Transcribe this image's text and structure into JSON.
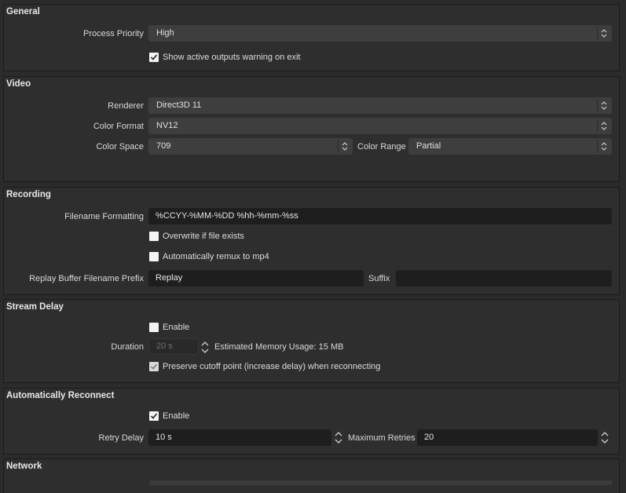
{
  "general": {
    "title": "General",
    "process_priority_label": "Process Priority",
    "process_priority_value": "High",
    "show_warning_label": "Show active outputs warning on exit",
    "show_warning_checked": true
  },
  "video": {
    "title": "Video",
    "renderer_label": "Renderer",
    "renderer_value": "Direct3D 11",
    "color_format_label": "Color Format",
    "color_format_value": "NV12",
    "color_space_label": "Color Space",
    "color_space_value": "709",
    "color_range_label": "Color Range",
    "color_range_value": "Partial"
  },
  "recording": {
    "title": "Recording",
    "filename_formatting_label": "Filename Formatting",
    "filename_formatting_value": "%CCYY-%MM-%DD %hh-%mm-%ss",
    "overwrite_label": "Overwrite if file exists",
    "overwrite_checked": false,
    "remux_label": "Automatically remux to mp4",
    "remux_checked": false,
    "replay_prefix_label": "Replay Buffer Filename Prefix",
    "replay_prefix_value": "Replay",
    "suffix_label": "Suffix",
    "suffix_value": ""
  },
  "stream_delay": {
    "title": "Stream Delay",
    "enable_label": "Enable",
    "enable_checked": false,
    "duration_label": "Duration",
    "duration_value": "20 s",
    "memory_label": "Estimated Memory Usage: 15 MB",
    "preserve_label": "Preserve cutoff point (increase delay) when reconnecting",
    "preserve_checked": true
  },
  "auto_reconnect": {
    "title": "Automatically Reconnect",
    "enable_label": "Enable",
    "enable_checked": true,
    "retry_delay_label": "Retry Delay",
    "retry_delay_value": "10 s",
    "max_retries_label": "Maximum Retries",
    "max_retries_value": "20"
  },
  "network": {
    "title": "Network"
  },
  "colors": {
    "background": "#2b2b2b",
    "group_background": "#2e2e2e",
    "combo_background": "#3e3e3e",
    "input_background": "#1e1e1e",
    "text": "#dcdcdc"
  }
}
